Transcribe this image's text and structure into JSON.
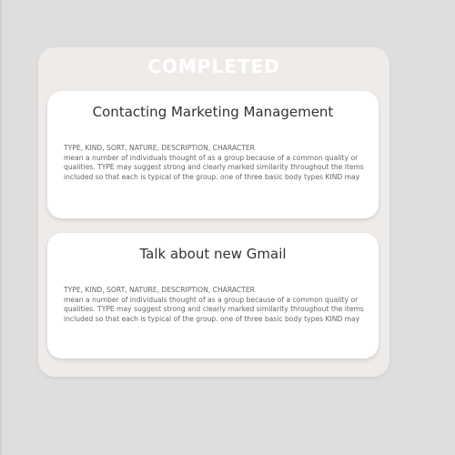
{
  "panel": {
    "title": "COMPLETED"
  },
  "cards": [
    {
      "title": "Contacting Marketing Management",
      "heading": "TYPE, KIND, SORT, NATURE, DESCRIPTION, CHARACTER",
      "text": "mean a number of individuals thought of as a group because of a common quality or qualities.  TYPE may suggest strong and clearly marked similarity throughout the items included so that each is typical of the group.  one of three basic body types KIND may"
    },
    {
      "title": "Talk about new Gmail",
      "heading": "TYPE, KIND, SORT, NATURE, DESCRIPTION, CHARACTER",
      "text": "mean a number of individuals thought of as a group because of a common quality or qualities.  TYPE may suggest strong and clearly marked similarity throughout the items included so that each is typical of the group.  one of three basic body types KIND may"
    }
  ],
  "colors": {
    "background": "#dedede",
    "panel": "#efebe9",
    "card": "#ffffff",
    "title_text": "#333333",
    "body_text": "#666666"
  }
}
